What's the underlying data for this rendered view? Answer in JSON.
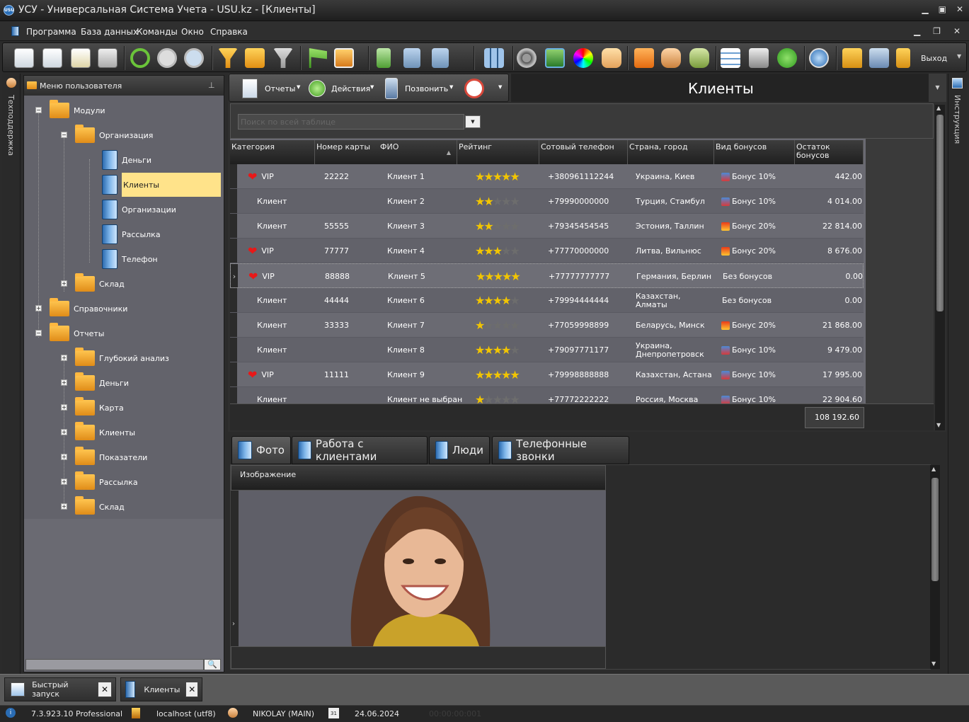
{
  "window": {
    "title": "УСУ - Универсальная Система Учета - USU.kz - [Клиенты]",
    "app_icon": "usu"
  },
  "menu": [
    "Программа",
    "База данных",
    "Команды",
    "Окно",
    "Справка"
  ],
  "toolbar": {
    "exit_label": "Выход"
  },
  "left_tab": "Техподдержка",
  "right_tab": "Инструкция",
  "sidebar": {
    "title": "Меню пользователя",
    "tree": [
      {
        "label": "Модули",
        "type": "folder",
        "expander": "−"
      },
      {
        "label": "Организация",
        "type": "folder",
        "expander": "−"
      },
      {
        "label": "Деньги",
        "type": "book"
      },
      {
        "label": "Клиенты",
        "type": "book",
        "selected": true
      },
      {
        "label": "Организации",
        "type": "book"
      },
      {
        "label": "Рассылка",
        "type": "book"
      },
      {
        "label": "Телефон",
        "type": "book"
      },
      {
        "label": "Склад",
        "type": "folder",
        "expander": "+"
      },
      {
        "label": "Справочники",
        "type": "folder",
        "expander": "+"
      },
      {
        "label": "Отчеты",
        "type": "folder",
        "expander": "−"
      },
      {
        "label": "Глубокий анализ",
        "type": "folder",
        "expander": "+"
      },
      {
        "label": "Деньги",
        "type": "folder",
        "expander": "+"
      },
      {
        "label": "Карта",
        "type": "folder",
        "expander": "+"
      },
      {
        "label": "Клиенты",
        "type": "folder",
        "expander": "+"
      },
      {
        "label": "Показатели",
        "type": "folder",
        "expander": "+"
      },
      {
        "label": "Рассылка",
        "type": "folder",
        "expander": "+"
      },
      {
        "label": "Склад",
        "type": "folder",
        "expander": "+"
      }
    ]
  },
  "main": {
    "title": "Клиенты",
    "buttons": {
      "reports": "Отчеты",
      "actions": "Действия",
      "call": "Позвонить"
    },
    "search_placeholder": "Поиск по всей таблице",
    "columns": [
      "Категория",
      "Номер карты",
      "ФИО",
      "Рейтинг",
      "Сотовый телефон",
      "Страна, город",
      "Вид бонусов",
      "Остаток бонусов"
    ],
    "rows": [
      {
        "vip": true,
        "category": "VIP",
        "card": "22222",
        "name": "Клиент 1",
        "rating": 5,
        "phone": "+380961112244",
        "city": "Украина, Киев",
        "bonus_type": "Бонус 10%",
        "bonus_icon": "blue",
        "balance": "442.00"
      },
      {
        "vip": false,
        "category": "Клиент",
        "card": "",
        "name": "Клиент 2",
        "rating": 2,
        "phone": "+79990000000",
        "city": "Турция, Стамбул",
        "bonus_type": "Бонус 10%",
        "bonus_icon": "blue",
        "balance": "4 014.00"
      },
      {
        "vip": false,
        "category": "Клиент",
        "card": "55555",
        "name": "Клиент 3",
        "rating": 2,
        "phone": "+79345454545",
        "city": "Эстония, Таллин",
        "bonus_type": "Бонус 20%",
        "bonus_icon": "gold",
        "balance": "22 814.00"
      },
      {
        "vip": true,
        "category": "VIP",
        "card": "77777",
        "name": "Клиент 4",
        "rating": 3,
        "phone": "+77770000000",
        "city": "Литва, Вильнюс",
        "bonus_type": "Бонус 20%",
        "bonus_icon": "gold",
        "balance": "8 676.00"
      },
      {
        "vip": true,
        "category": "VIP",
        "card": "88888",
        "name": "Клиент 5",
        "rating": 5,
        "phone": "+77777777777",
        "city": "Германия, Берлин",
        "bonus_type": "Без бонусов",
        "bonus_icon": "",
        "balance": "0.00",
        "current": true
      },
      {
        "vip": false,
        "category": "Клиент",
        "card": "44444",
        "name": "Клиент 6",
        "rating": 4,
        "phone": "+79994444444",
        "city": "Казахстан, Алматы",
        "bonus_type": "Без бонусов",
        "bonus_icon": "",
        "balance": "0.00"
      },
      {
        "vip": false,
        "category": "Клиент",
        "card": "33333",
        "name": "Клиент 7",
        "rating": 1,
        "phone": "+77059998899",
        "city": "Беларусь, Минск",
        "bonus_type": "Бонус 20%",
        "bonus_icon": "gold",
        "balance": "21 868.00"
      },
      {
        "vip": false,
        "category": "Клиент",
        "card": "",
        "name": "Клиент 8",
        "rating": 4,
        "phone": "+79097771177",
        "city": "Украина, Днепропетровск",
        "bonus_type": "Бонус 10%",
        "bonus_icon": "blue",
        "balance": "9 479.00"
      },
      {
        "vip": true,
        "category": "VIP",
        "card": "11111",
        "name": "Клиент 9",
        "rating": 5,
        "phone": "+79998888888",
        "city": "Казахстан, Астана",
        "bonus_type": "Бонус 10%",
        "bonus_icon": "blue",
        "balance": "17 995.00"
      },
      {
        "vip": false,
        "category": "Клиент",
        "card": "",
        "name": "Клиент не выбран",
        "rating": 1,
        "phone": "+77772222222",
        "city": "Россия, Москва",
        "bonus_type": "Бонус 10%",
        "bonus_icon": "blue",
        "balance": "22 904.60"
      }
    ],
    "total": "108 192.60"
  },
  "bottom": {
    "tabs": [
      "Фото",
      "Работа с клиентами",
      "Люди",
      "Телефонные звонки"
    ],
    "image_header": "Изображение"
  },
  "taskbar": [
    {
      "label": "Быстрый запуск"
    },
    {
      "label": "Клиенты"
    }
  ],
  "status": {
    "version": "7.3.923.10 Professional",
    "db": "localhost (utf8)",
    "user": "NIKOLAY (MAIN)",
    "date": "24.06.2024",
    "timer": "00:00:00:001",
    "calendar_day": "31"
  }
}
